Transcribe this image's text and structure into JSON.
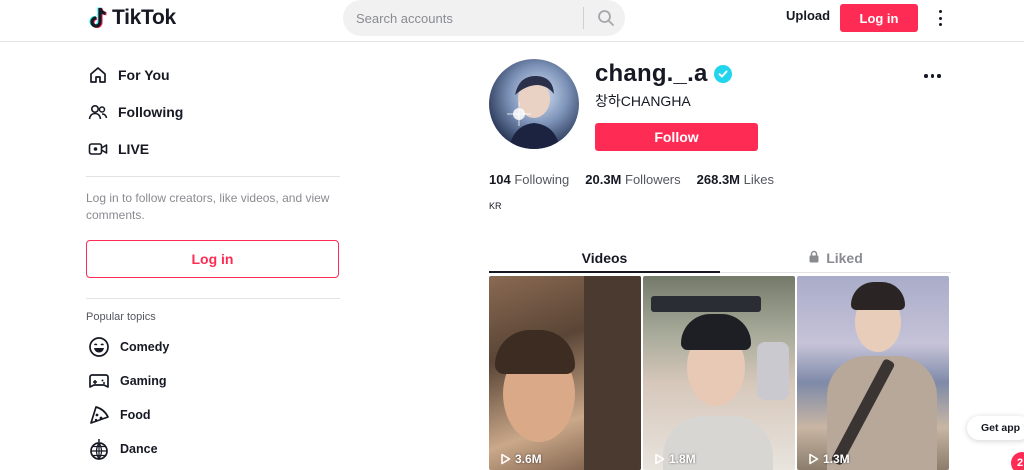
{
  "header": {
    "logo_text": "TikTok",
    "logo_icon": "tiktok-note-icon",
    "search": {
      "placeholder": "Search accounts",
      "value": "",
      "icon": "search-icon"
    },
    "upload_label": "Upload",
    "login_label": "Log in",
    "more_icon": "vertical-dots-icon"
  },
  "sidebar": {
    "nav": [
      {
        "label": "For You",
        "icon": "home-icon"
      },
      {
        "label": "Following",
        "icon": "users-icon"
      },
      {
        "label": "LIVE",
        "icon": "live-camera-icon"
      }
    ],
    "login_hint": "Log in to follow creators, like videos, and view comments.",
    "login_label": "Log in",
    "popular_title": "Popular topics",
    "topics": [
      {
        "label": "Comedy",
        "icon": "smile-icon"
      },
      {
        "label": "Gaming",
        "icon": "gamepad-icon"
      },
      {
        "label": "Food",
        "icon": "pizza-icon"
      },
      {
        "label": "Dance",
        "icon": "disco-ball-icon"
      }
    ]
  },
  "profile": {
    "username": "chang._.a",
    "verified": true,
    "nickname": "창하CHANGHA",
    "follow_label": "Follow",
    "stats": [
      {
        "value": "104",
        "label": "Following"
      },
      {
        "value": "20.3M",
        "label": "Followers"
      },
      {
        "value": "268.3M",
        "label": "Likes"
      }
    ],
    "bio": "KR",
    "tabs": [
      {
        "label": "Videos",
        "active": true
      },
      {
        "label": "Liked",
        "active": false,
        "icon": "lock-icon"
      }
    ],
    "videos": [
      {
        "views": "3.6M"
      },
      {
        "views": "1.8M"
      },
      {
        "views": "1.3M"
      }
    ]
  },
  "floating": {
    "get_app_label": "Get app",
    "badge": "2"
  },
  "colors": {
    "brand": "#fe2c55",
    "verified": "#20d5ec",
    "text": "#161823",
    "muted": "#8a8b91"
  }
}
